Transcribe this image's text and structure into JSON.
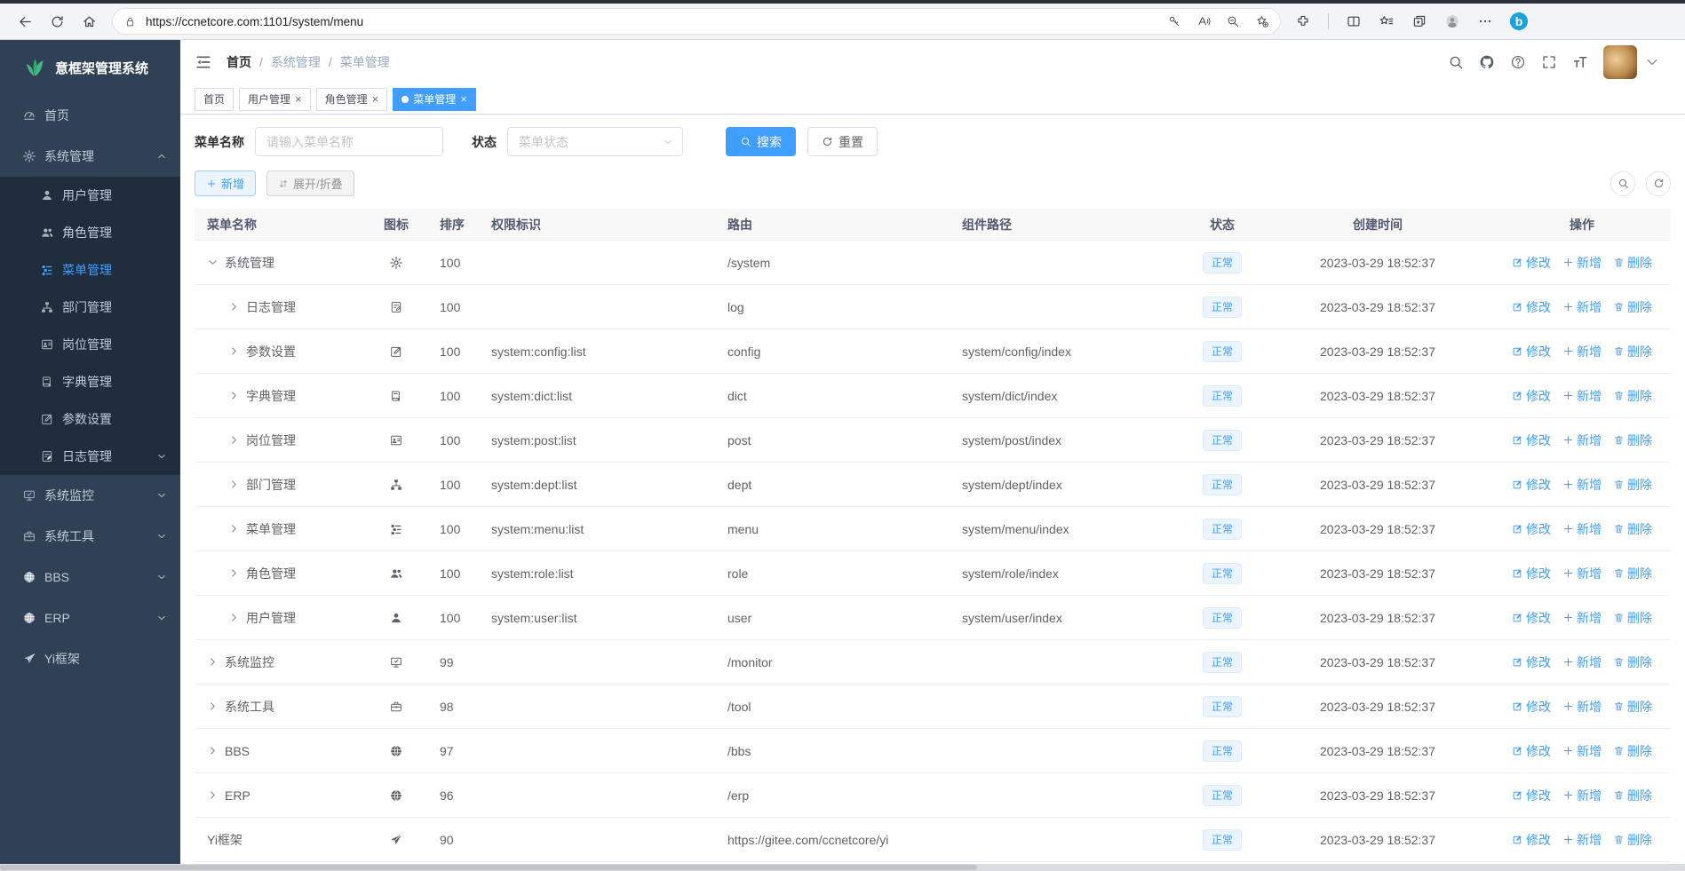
{
  "colors": {
    "primary": "#409eff",
    "sidebar_bg": "#304156",
    "submenu_bg": "#1f2d3d",
    "active_tab_bg": "#409eff",
    "tag_bg": "#ecf5ff",
    "tag_border": "#d9ecff",
    "logo_green": "#42b983"
  },
  "browser": {
    "url": "https://ccnetcore.com:1101/system/menu",
    "left_icons": [
      "back-icon",
      "reload-icon",
      "home-icon"
    ],
    "lock_icon": "lock-icon",
    "pill_icons": [
      "key-icon",
      "read-aloud-icon",
      "zoom-out-icon",
      "favorite-add-icon"
    ],
    "right_icons": [
      "extensions-icon",
      "divider",
      "split-screen-icon",
      "favorites-icon",
      "collections-icon",
      "profile-icon",
      "more-icon"
    ],
    "bing_icon": "bing-icon"
  },
  "app": {
    "title": "意框架管理系统",
    "logo_icon": "grass-icon"
  },
  "sidebar": {
    "items": [
      {
        "label": "首页",
        "icon": "dashboard-icon"
      },
      {
        "label": "系统管理",
        "icon": "gear-icon",
        "caret": "up",
        "children": [
          {
            "label": "用户管理",
            "icon": "user-icon"
          },
          {
            "label": "角色管理",
            "icon": "users-icon"
          },
          {
            "label": "菜单管理",
            "icon": "menu-icon",
            "active": true
          },
          {
            "label": "部门管理",
            "icon": "org-icon"
          },
          {
            "label": "岗位管理",
            "icon": "idcard-icon"
          },
          {
            "label": "字典管理",
            "icon": "book-icon"
          },
          {
            "label": "参数设置",
            "icon": "edit-icon"
          },
          {
            "label": "日志管理",
            "icon": "log-icon",
            "caret": "down"
          }
        ]
      },
      {
        "label": "系统监控",
        "icon": "monitor-icon",
        "caret": "down"
      },
      {
        "label": "系统工具",
        "icon": "toolbox-icon",
        "caret": "down"
      },
      {
        "label": "BBS",
        "icon": "globe-icon",
        "caret": "down"
      },
      {
        "label": "ERP",
        "icon": "globe-icon",
        "caret": "down"
      },
      {
        "label": "Yi框架",
        "icon": "send-icon"
      }
    ]
  },
  "navbar": {
    "fold_icon": "fold-icon",
    "breadcrumb": [
      "首页",
      "系统管理",
      "菜单管理"
    ],
    "icons": [
      "search-icon",
      "github-icon",
      "question-icon",
      "fullscreen-icon",
      "font-size-icon"
    ],
    "avatar": "user-avatar"
  },
  "tabs": [
    {
      "label": "首页",
      "closable": false,
      "active": false
    },
    {
      "label": "用户管理",
      "closable": true,
      "active": false
    },
    {
      "label": "角色管理",
      "closable": true,
      "active": false
    },
    {
      "label": "菜单管理",
      "closable": true,
      "active": true
    }
  ],
  "filters": {
    "name_label": "菜单名称",
    "name_placeholder": "请输入菜单名称",
    "name_value": "",
    "status_label": "状态",
    "status_placeholder": "菜单状态",
    "search_label": "搜索",
    "reset_label": "重置"
  },
  "toolbar": {
    "add_label": "新增",
    "expand_label": "展开/折叠",
    "mini_icons": [
      "search-icon",
      "refresh-icon"
    ]
  },
  "table": {
    "columns": [
      "菜单名称",
      "图标",
      "排序",
      "权限标识",
      "路由",
      "组件路径",
      "状态",
      "创建时间",
      "操作"
    ],
    "ops": [
      {
        "label": "修改",
        "icon": "edit-pencil-icon"
      },
      {
        "label": "新增",
        "icon": "plus-icon"
      },
      {
        "label": "删除",
        "icon": "trash-icon"
      }
    ],
    "rows": [
      {
        "name": "系统管理",
        "caret": "down",
        "icon": "gear-icon",
        "sort": "100",
        "perms": "",
        "route": "/system",
        "component": "",
        "status": "正常",
        "time": "2023-03-29 18:52:37",
        "child": false
      },
      {
        "name": "日志管理",
        "caret": "right",
        "icon": "log-icon",
        "sort": "100",
        "perms": "",
        "route": "log",
        "component": "",
        "status": "正常",
        "time": "2023-03-29 18:52:37",
        "child": true
      },
      {
        "name": "参数设置",
        "caret": "right",
        "icon": "edit-icon",
        "sort": "100",
        "perms": "system:config:list",
        "route": "config",
        "component": "system/config/index",
        "status": "正常",
        "time": "2023-03-29 18:52:37",
        "child": true
      },
      {
        "name": "字典管理",
        "caret": "right",
        "icon": "book-icon",
        "sort": "100",
        "perms": "system:dict:list",
        "route": "dict",
        "component": "system/dict/index",
        "status": "正常",
        "time": "2023-03-29 18:52:37",
        "child": true
      },
      {
        "name": "岗位管理",
        "caret": "right",
        "icon": "idcard-icon",
        "sort": "100",
        "perms": "system:post:list",
        "route": "post",
        "component": "system/post/index",
        "status": "正常",
        "time": "2023-03-29 18:52:37",
        "child": true
      },
      {
        "name": "部门管理",
        "caret": "right",
        "icon": "org-icon",
        "sort": "100",
        "perms": "system:dept:list",
        "route": "dept",
        "component": "system/dept/index",
        "status": "正常",
        "time": "2023-03-29 18:52:37",
        "child": true
      },
      {
        "name": "菜单管理",
        "caret": "right",
        "icon": "menu-icon",
        "sort": "100",
        "perms": "system:menu:list",
        "route": "menu",
        "component": "system/menu/index",
        "status": "正常",
        "time": "2023-03-29 18:52:37",
        "child": true
      },
      {
        "name": "角色管理",
        "caret": "right",
        "icon": "users-icon",
        "sort": "100",
        "perms": "system:role:list",
        "route": "role",
        "component": "system/role/index",
        "status": "正常",
        "time": "2023-03-29 18:52:37",
        "child": true
      },
      {
        "name": "用户管理",
        "caret": "right",
        "icon": "user-icon",
        "sort": "100",
        "perms": "system:user:list",
        "route": "user",
        "component": "system/user/index",
        "status": "正常",
        "time": "2023-03-29 18:52:37",
        "child": true
      },
      {
        "name": "系统监控",
        "caret": "right",
        "icon": "monitor-icon",
        "sort": "99",
        "perms": "",
        "route": "/monitor",
        "component": "",
        "status": "正常",
        "time": "2023-03-29 18:52:37",
        "child": false
      },
      {
        "name": "系统工具",
        "caret": "right",
        "icon": "toolbox-icon",
        "sort": "98",
        "perms": "",
        "route": "/tool",
        "component": "",
        "status": "正常",
        "time": "2023-03-29 18:52:37",
        "child": false
      },
      {
        "name": "BBS",
        "caret": "right",
        "icon": "globe-icon",
        "sort": "97",
        "perms": "",
        "route": "/bbs",
        "component": "",
        "status": "正常",
        "time": "2023-03-29 18:52:37",
        "child": false
      },
      {
        "name": "ERP",
        "caret": "right",
        "icon": "globe-icon",
        "sort": "96",
        "perms": "",
        "route": "/erp",
        "component": "",
        "status": "正常",
        "time": "2023-03-29 18:52:37",
        "child": false
      },
      {
        "name": "Yi框架",
        "caret": "none",
        "icon": "send-icon",
        "sort": "90",
        "perms": "",
        "route": "https://gitee.com/ccnetcore/yi",
        "component": "",
        "status": "正常",
        "time": "2023-03-29 18:52:37",
        "child": false
      }
    ]
  }
}
